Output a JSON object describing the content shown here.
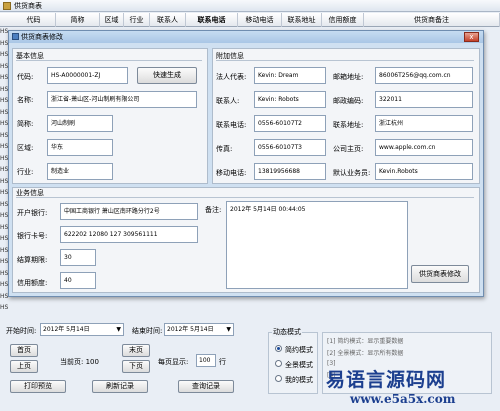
{
  "parent": {
    "title": "供货商表",
    "columns": [
      "代码",
      "简称",
      "区域",
      "行业",
      "联系人",
      "联系电话",
      "移动电话",
      "联系地址",
      "信用额度",
      "供货商备注"
    ],
    "row_stubs": [
      "HS",
      "HS",
      "HS",
      "HS",
      "HS",
      "HS",
      "HS",
      "HS",
      "HS",
      "HS",
      "HS",
      "HS",
      "HS",
      "HS",
      "HS",
      "HS",
      "HS",
      "HS",
      "HS",
      "HS",
      "HS",
      "HS",
      "HS",
      "HS",
      "HS"
    ]
  },
  "dialog": {
    "title": "供货商表修改",
    "close": "x",
    "basic": {
      "group": "基本信息",
      "code_label": "代码:",
      "code_value": "HS-A0000001-ZJ",
      "generate_button": "快速生成",
      "name_label": "名称:",
      "name_value": "浙江省-萧山区-河山制刷有限公司",
      "short_label": "简称:",
      "short_value": "河山制刷",
      "region_label": "区域:",
      "region_value": "华东",
      "industry_label": "行业:",
      "industry_value": "制造业"
    },
    "extra": {
      "group": "附加信息",
      "rep_label": "法人代表:",
      "rep_value": "Kevin: Dream",
      "contact_label": "联系人:",
      "contact_value": "Kevin: Robots",
      "phone_label": "联系电话:",
      "phone_value": "0556-60107T2",
      "fax_label": "传真:",
      "fax_value": "0556-60107T3",
      "mobile_label": "移动电话:",
      "mobile_value": "13819956688",
      "email_label": "邮箱地址:",
      "email_value": "86006T256@qq.com.cn",
      "zip_label": "邮政编码:",
      "zip_value": "322011",
      "addr_label": "联系地址:",
      "addr_value": "浙江杭州",
      "web_label": "公司主页:",
      "web_value": "www.apple.com.cn",
      "sales_label": "默认业务员:",
      "sales_value": "Kevin.Robots"
    },
    "business": {
      "group": "业务信息",
      "bank_label": "开户银行:",
      "bank_value": "中国工商银行 萧山区南环路分行2号",
      "card_label": "银行卡号:",
      "card_value": "622202 12080 127 309561111",
      "days_label": "结算期限:",
      "days_value": "30",
      "credit_label": "信用额度:",
      "credit_value": "40",
      "remark_label": "备注:",
      "remark_value": "2012年 5月14日 00:44:05",
      "submit_button": "供货商表修改"
    }
  },
  "bottom": {
    "start_label": "开始时间:",
    "start_value": "2012年 5月14日",
    "end_label": "结束时间:",
    "end_value": "2012年 5月14日",
    "first": "首页",
    "prev": "上页",
    "last": "末页",
    "next": "下页",
    "page_label": "当前页: 100",
    "per_page_label": "每页显示:",
    "per_page_value": "100",
    "per_page_unit": "行",
    "print": "打印预览",
    "refresh": "刷新记录",
    "query": "查询记录",
    "mode_group": "动态模式",
    "modes": [
      "简约模式",
      "全景模式",
      "我的模式"
    ],
    "notes": [
      "[1] 简约模式：显示重要数据",
      "[2] 全景模式：显示所有数据",
      "[3] ",
      "[4] "
    ],
    "watermark": "易语言源码网",
    "watermark_url": "www.e5a5x.com"
  }
}
